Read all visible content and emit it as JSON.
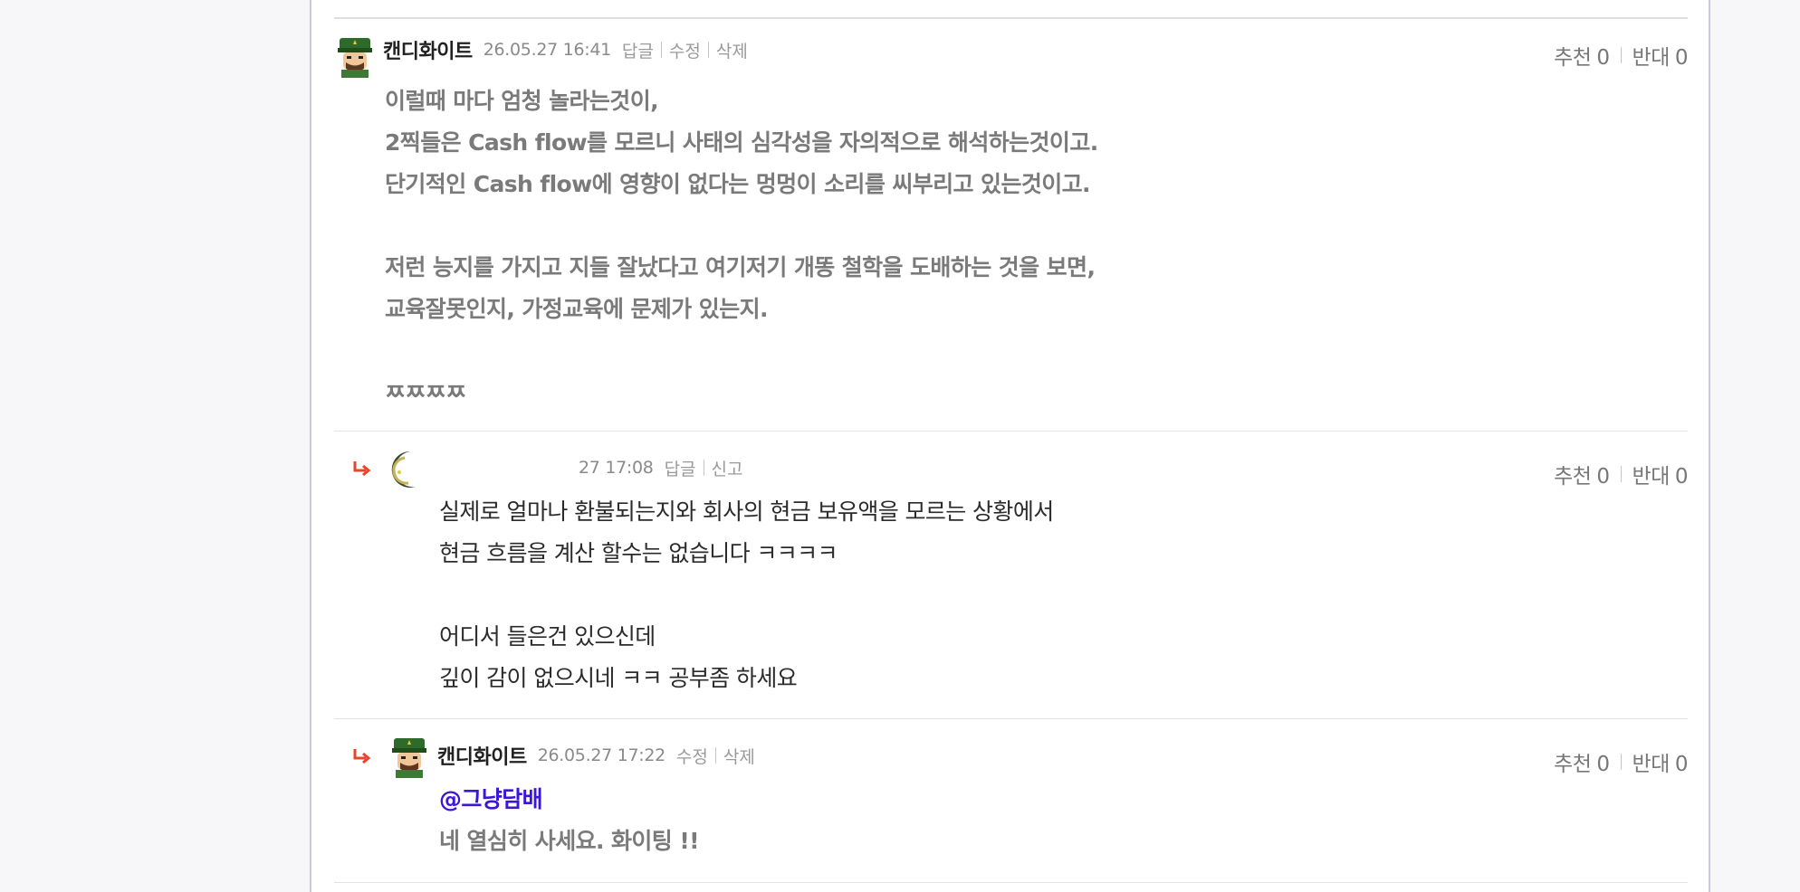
{
  "comments": [
    {
      "nickname": "캔디화이트",
      "datetime": "26.05.27 16:41",
      "actions": [
        "답글",
        "수정",
        "삭제"
      ],
      "votes": {
        "up_label": "추천",
        "up": "0",
        "down_label": "반대",
        "down": "0"
      },
      "lines": [
        "이럴때 마다 엄청 놀라는것이,",
        "2찍들은 Cash flow를 모르니 사태의 심각성을 자의적으로 해석하는것이고.",
        "단기적인 Cash flow에 영향이 없다는 멍멍이 소리를 씨부리고 있는것이고.",
        "",
        "저런 능지를 가지고 지들 잘났다고 여기저기 개똥 철학을 도배하는 것을 보면,",
        "교육잘못인지, 가정교육에 문제가 있는지.",
        "",
        "ㅉㅉㅉㅉ"
      ]
    },
    {
      "nickname": "",
      "datetime": "27 17:08",
      "actions": [
        "답글",
        "신고"
      ],
      "votes": {
        "up_label": "추천",
        "up": "0",
        "down_label": "반대",
        "down": "0"
      },
      "lines": [
        "실제로 얼마나 환불되는지와 회사의 현금 보유액을 모르는 상황에서",
        "현금 흐름을 계산 할수는 없습니다 ㅋㅋㅋㅋ",
        "",
        "어디서 들은건 있으신데",
        "깊이 감이 없으시네 ㅋㅋ 공부좀 하세요"
      ]
    },
    {
      "nickname": "캔디화이트",
      "datetime": "26.05.27 17:22",
      "actions": [
        "수정",
        "삭제"
      ],
      "votes": {
        "up_label": "추천",
        "up": "0",
        "down_label": "반대",
        "down": "0"
      },
      "mention": "@그냥담배",
      "lines": [
        "네 열심히 사세요. 화이팅 !!"
      ]
    }
  ],
  "colors": {
    "accent_mention": "#3b16d6",
    "reply_arrow": "#e8452a"
  },
  "icons": {
    "reply": "reply-arrow-icon",
    "avatar_general": "general-avatar-icon",
    "avatar_moon": "moon-avatar-icon"
  }
}
